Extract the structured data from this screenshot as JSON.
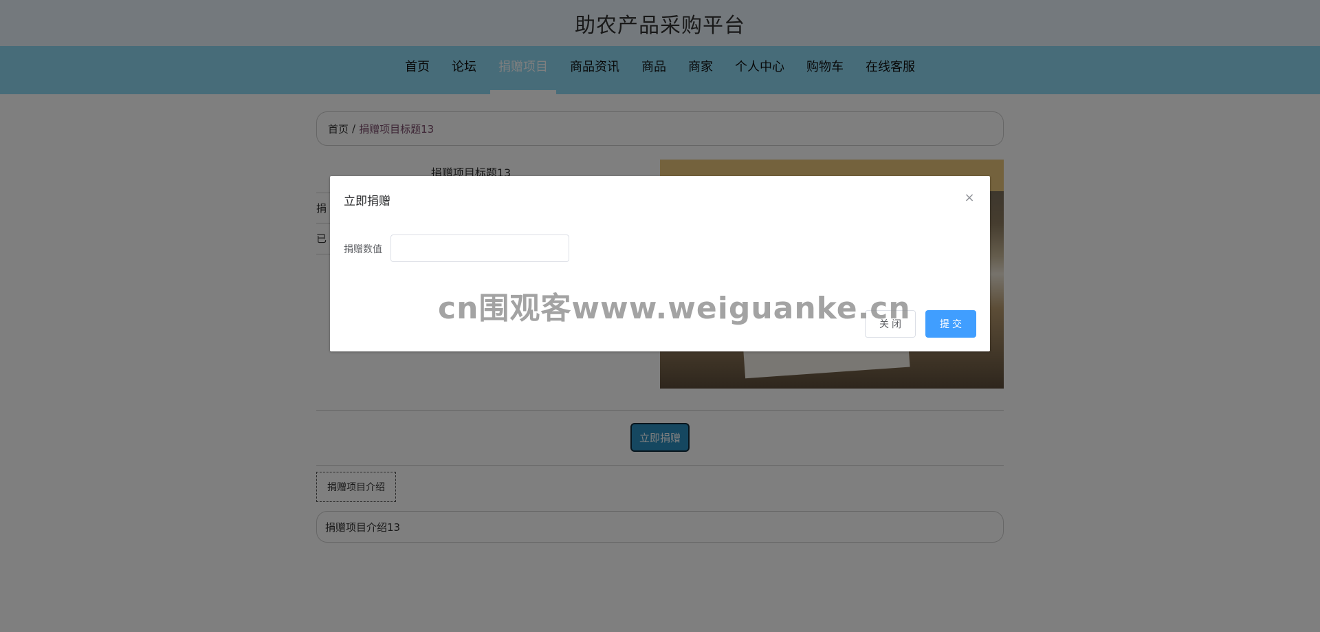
{
  "header": {
    "title": "助农产品采购平台"
  },
  "nav": {
    "items": [
      {
        "label": "首页"
      },
      {
        "label": "论坛"
      },
      {
        "label": "捐赠项目",
        "active": true
      },
      {
        "label": "商品资讯"
      },
      {
        "label": "商品"
      },
      {
        "label": "商家"
      },
      {
        "label": "个人中心"
      },
      {
        "label": "购物车"
      },
      {
        "label": "在线客服"
      }
    ]
  },
  "breadcrumb": {
    "home": "首页",
    "separator": "/",
    "current": "捐赠项目标题13"
  },
  "detail": {
    "title": "捐赠项目标题13",
    "row1_label": "捐",
    "row2_label": "已"
  },
  "actions": {
    "donate_label": "立即捐赠"
  },
  "intro": {
    "tab_label": "捐赠项目介绍",
    "content": "捐赠项目介绍13"
  },
  "modal": {
    "title": "立即捐赠",
    "close_symbol": "×",
    "field_label": "捐赠数值",
    "field_value": "",
    "field_placeholder": "",
    "cancel_label": "关闭",
    "submit_label": "提交"
  },
  "watermark": {
    "text": "cn围观客www.weiguanke.cn"
  },
  "colors": {
    "nav_background": "#8fd8f3",
    "header_background": "#e9f3fb",
    "primary_button": "#409eff",
    "donate_button": "#2a8fc0"
  }
}
